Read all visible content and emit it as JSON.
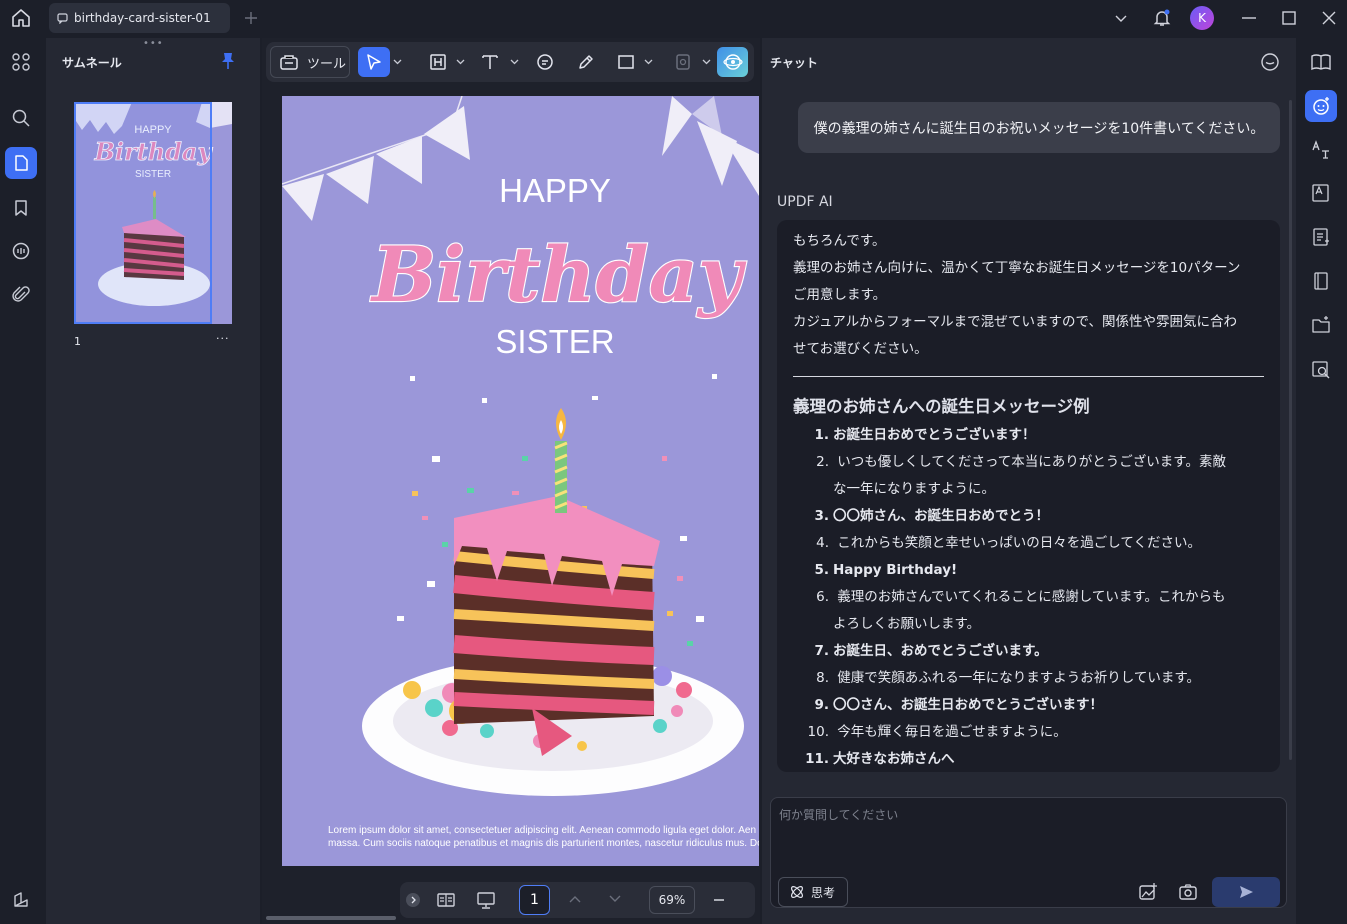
{
  "window": {
    "tab_title": "birthday-card-sister-01",
    "avatar_initial": "K"
  },
  "thumbnails": {
    "title": "サムネール",
    "page_number": "1",
    "more": "···"
  },
  "toolbar": {
    "tools_label": "ツール"
  },
  "card": {
    "happy": "HAPPY",
    "birthday": "Birthday",
    "sister": "SISTER",
    "lorem_line1": "Lorem ipsum dolor sit amet, consectetuer adipiscing elit. Aenean commodo ligula eget dolor. Aen",
    "lorem_line2": "massa. Cum sociis natoque penatibus et magnis dis parturient montes, nascetur ridiculus mus. Don"
  },
  "pager": {
    "page": "1",
    "zoom": "69%"
  },
  "chat": {
    "title": "チャット",
    "user_message": "僕の義理の姉さんに誕生日のお祝いメッセージを10件書いてください。",
    "ai_name": "UPDF AI",
    "intro": [
      "もちろんです。",
      "義理のお姉さん向けに、温かくて丁寧なお誕生日メッセージを10パターン",
      "ご用意します。",
      "カジュアルからフォーマルまで混ぜていますので、関係性や雰囲気に合わ",
      "せてお選びください。"
    ],
    "heading": "義理のお姉さんへの誕生日メッセージ例",
    "items": [
      {
        "n": "1.",
        "text": "お誕生日おめでとうございます！",
        "bold": true
      },
      {
        "n": "2.",
        "text": "いつも優しくしてくださって本当にありがとうございます。素敵",
        "bold": false
      },
      {
        "n": "",
        "text": "な一年になりますように。",
        "bold": false
      },
      {
        "n": "3.",
        "text": "〇〇姉さん、お誕生日おめでとう！",
        "bold": true
      },
      {
        "n": "4.",
        "text": "これからも笑顔と幸せいっぱいの日々を過ごしてください。",
        "bold": false
      },
      {
        "n": "5.",
        "text": "Happy Birthday!",
        "bold": true
      },
      {
        "n": "6.",
        "text": "義理のお姉さんでいてくれることに感謝しています。これからも",
        "bold": false
      },
      {
        "n": "",
        "text": "よろしくお願いします。",
        "bold": false
      },
      {
        "n": "7.",
        "text": "お誕生日、おめでとうございます。",
        "bold": true
      },
      {
        "n": "8.",
        "text": "健康で笑顔あふれる一年になりますようお祈りしています。",
        "bold": false
      },
      {
        "n": "9.",
        "text": "〇〇さん、お誕生日おめでとうございます！",
        "bold": true
      },
      {
        "n": "10.",
        "text": "今年も輝く毎日を過ごせますように。",
        "bold": false
      },
      {
        "n": "11.",
        "text": "大好きなお姉さんへ",
        "bold": true
      }
    ],
    "input_placeholder": "何か質問してください",
    "think_label": "思考"
  },
  "colors": {
    "accent": "#3e6ff4",
    "card_bg": "#9b97d9",
    "birthday_pink": "#f08ab8"
  }
}
